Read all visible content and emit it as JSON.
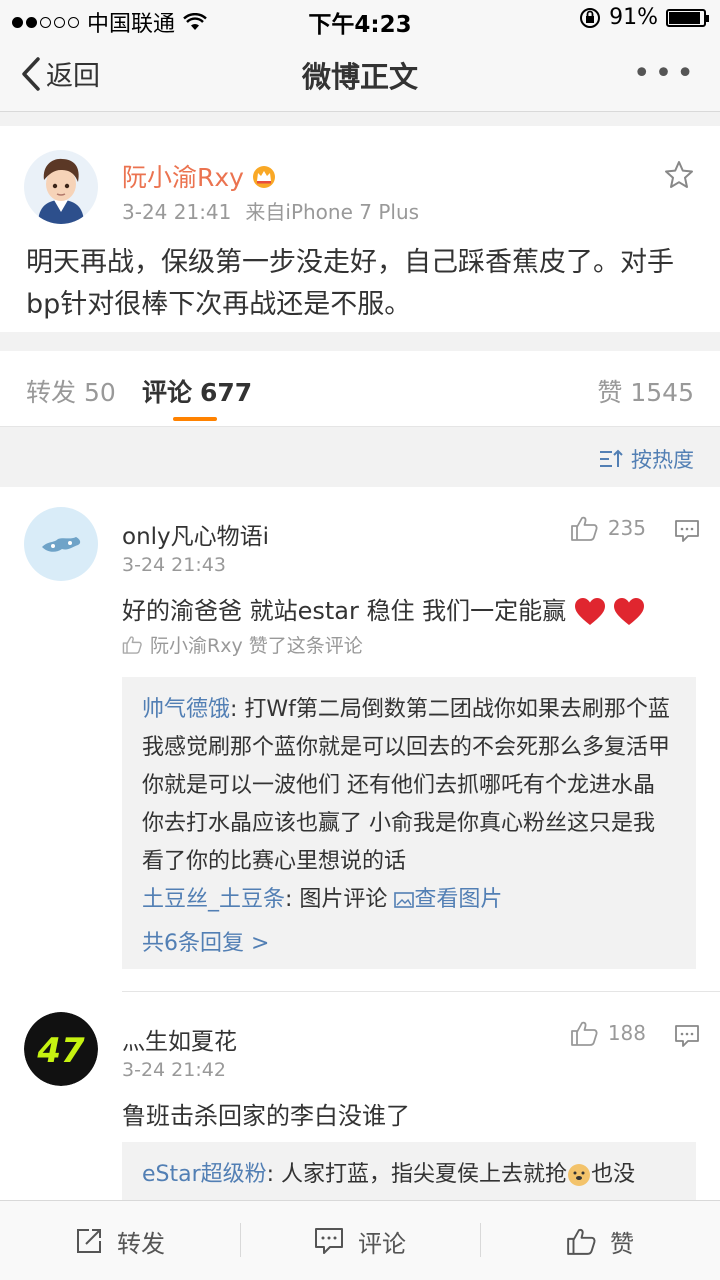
{
  "status_bar": {
    "carrier": "中国联通",
    "time": "下午4:23",
    "battery_text": "91%",
    "battery_level": 0.91
  },
  "nav": {
    "back_label": "返回",
    "title": "微博正文",
    "more_label": "•••"
  },
  "post": {
    "author": "阮小渝Rxy",
    "time": "3-24 21:41",
    "source": "来自iPhone 7 Plus",
    "text": "明天再战，保级第一步没走好，自己踩香蕉皮了。对手bp针对很棒下次再战还是不服。"
  },
  "tabs": {
    "repost_label": "转发",
    "repost_count": "50",
    "comment_label": "评论",
    "comment_count": "677",
    "like_label": "赞",
    "like_count": "1545",
    "sort_label": "按热度"
  },
  "comments": [
    {
      "name": "only凡心物语i",
      "time": "3-24 21:43",
      "likes": "235",
      "text": "好的渝爸爸 就站estar 稳住 我们一定能赢",
      "liked_by": "阮小渝Rxy 赞了这条评论",
      "reply1_user": "帅气德饿",
      "reply1_text": ": 打Wf第二局倒数第二团战你如果去刷那个蓝我感觉刷那个蓝你就是可以回去的不会死那么多复活甲你就是可以一波他们  还有他们去抓哪吒有个龙进水晶你去打水晶应该也赢了  小俞我是你真心粉丝这只是我看了你的比赛心里想说的话",
      "reply2_user": "土豆丝_土豆条",
      "reply2_text": ": 图片评论",
      "reply2_link": "查看图片",
      "more_replies": "共6条回复 >"
    },
    {
      "name": "灬生如夏花",
      "time": "3-24 21:42",
      "likes": "188",
      "text": "鲁班击杀回家的李白没谁了",
      "reply1_user": "eStar超级粉",
      "reply1_text": ": 人家打蓝，指尖夏侯上去就抢",
      "reply1_tail": "也没"
    }
  ],
  "bottom_bar": {
    "repost": "转发",
    "comment": "评论",
    "like": "赞"
  }
}
